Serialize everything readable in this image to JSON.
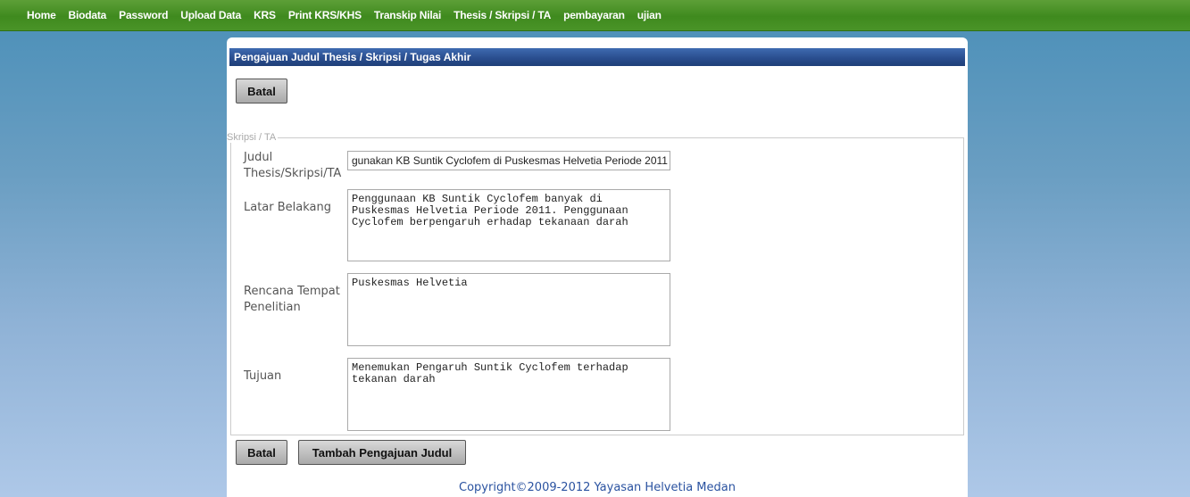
{
  "nav": {
    "items": [
      "Home",
      "Biodata",
      "Password",
      "Upload Data",
      "KRS",
      "Print KRS/KHS",
      "Transkip Nilai",
      "Thesis / Skripsi / TA",
      "pembayaran",
      "ujian"
    ]
  },
  "panel": {
    "title": "Pengajuan Judul Thesis / Skripsi / Tugas Akhir",
    "top_button": "Batal",
    "fieldset_legend": "Skripsi / TA",
    "fields": {
      "judul": {
        "label_line1": "Judul",
        "label_line2": "Thesis/Skripsi/TA",
        "value": "gunakan KB Suntik Cyclofem di Puskesmas Helvetia Periode 2011"
      },
      "latar": {
        "label": "Latar Belakang",
        "value": "Penggunaan KB Suntik Cyclofem banyak di Puskesmas Helvetia Periode 2011. Penggunaan Cyclofem berpengaruh erhadap tekanaan darah"
      },
      "rencana": {
        "label_line1": "Rencana Tempat",
        "label_line2": "Penelitian",
        "value": "Puskesmas Helvetia"
      },
      "tujuan": {
        "label": "Tujuan",
        "value": "Menemukan Pengaruh Suntik Cyclofem terhadap tekanan darah"
      }
    },
    "bottom_buttons": {
      "cancel": "Batal",
      "submit": "Tambah Pengajuan Judul"
    },
    "footer": "Copyright©2009-2012 Yayasan Helvetia Medan"
  }
}
